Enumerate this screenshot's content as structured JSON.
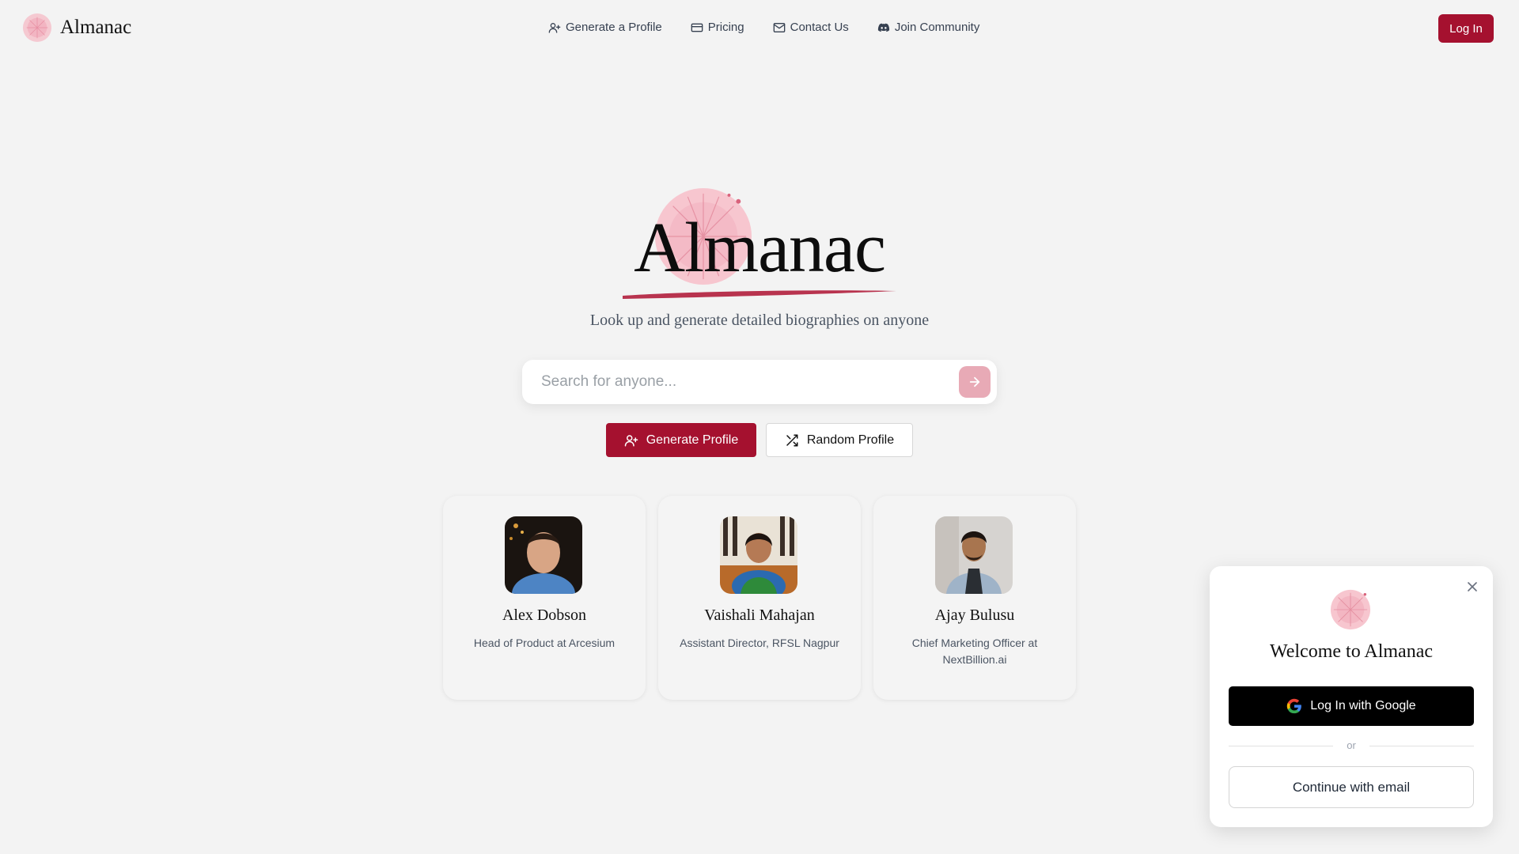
{
  "brand": {
    "name": "Almanac"
  },
  "nav": {
    "items": [
      {
        "label": "Generate a Profile",
        "icon": "user-plus-icon"
      },
      {
        "label": "Pricing",
        "icon": "credit-card-icon"
      },
      {
        "label": "Contact Us",
        "icon": "mail-icon"
      },
      {
        "label": "Join Community",
        "icon": "discord-icon"
      }
    ],
    "login_label": "Log In"
  },
  "hero": {
    "title": "Almanac",
    "tagline": "Look up and generate detailed biographies on anyone"
  },
  "search": {
    "placeholder": "Search for anyone...",
    "value": ""
  },
  "actions": {
    "generate_label": "Generate Profile",
    "random_label": "Random Profile"
  },
  "profiles": [
    {
      "name": "Alex Dobson",
      "role": "Head of Product at Arcesium"
    },
    {
      "name": "Vaishali Mahajan",
      "role": "Assistant Director, RFSL Nagpur"
    },
    {
      "name": "Ajay Bulusu",
      "role": "Chief Marketing Officer at NextBillion.ai"
    }
  ],
  "modal": {
    "title": "Welcome to Almanac",
    "google_label": "Log In with Google",
    "divider": "or",
    "email_label": "Continue with email"
  },
  "colors": {
    "accent": "#a5112f",
    "logo_pink": "#f2b9c4",
    "background": "#f3f3f3"
  }
}
